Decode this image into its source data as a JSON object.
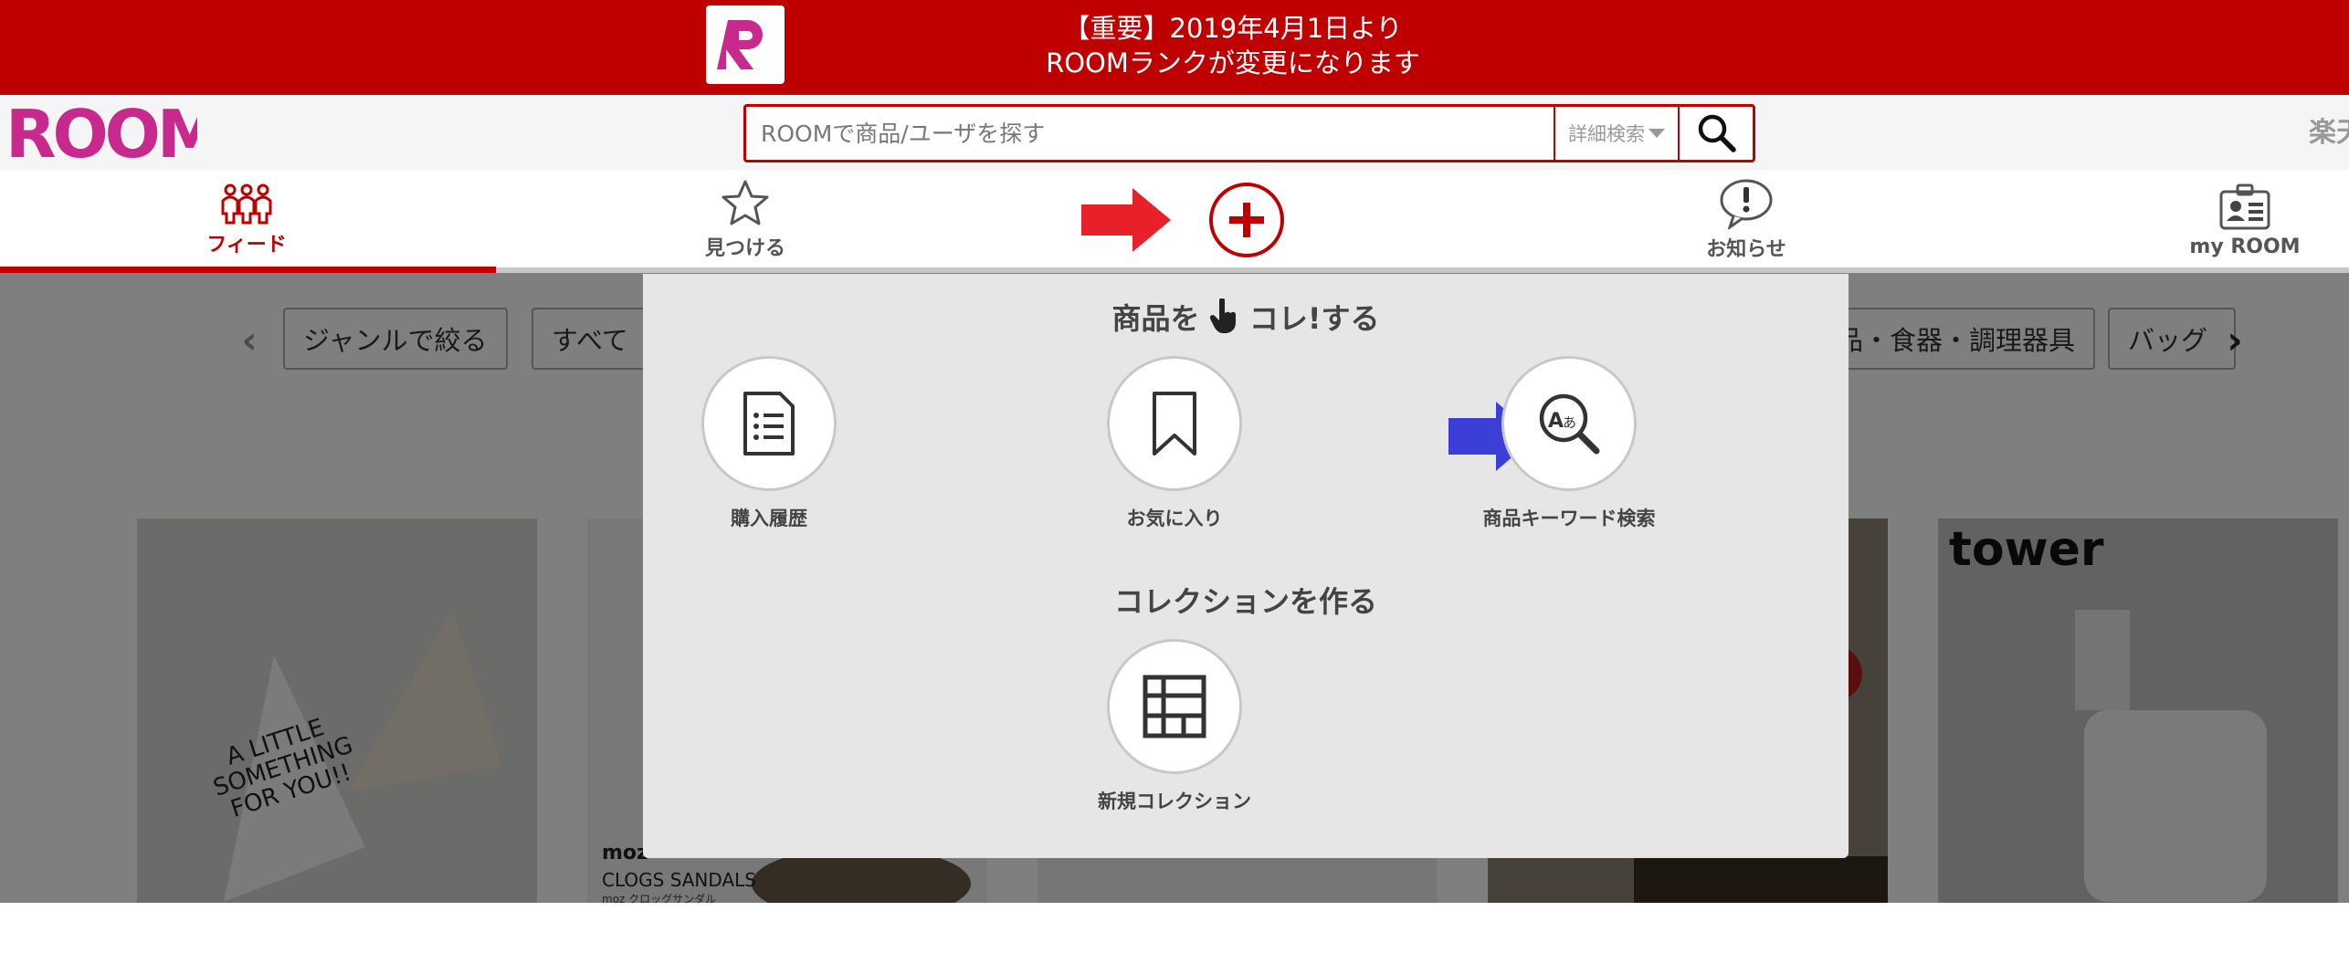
{
  "banner": {
    "line1": "【重要】2019年4月1日より",
    "line2": "ROOMランクが変更になります",
    "logo_letter": "R"
  },
  "header": {
    "logo_text": "ROOM",
    "search_placeholder": "ROOMで商品/ユーザを探す",
    "detail_search_label": "詳細検索",
    "rakuten_text": "楽天"
  },
  "nav": {
    "items": [
      {
        "label": "フィード",
        "icon": "people-icon",
        "active": true
      },
      {
        "label": "見つける",
        "icon": "star-icon"
      },
      {
        "label": "お知らせ",
        "icon": "notification-icon"
      },
      {
        "label": "my ROOM",
        "icon": "id-card-icon"
      }
    ]
  },
  "filters": {
    "genre_label": "ジャンルで絞る",
    "all_label": "すべて",
    "partial_label": "品・食器・調理器具",
    "bag_label": "バッグ"
  },
  "cards": {
    "card1_text": "A LITTLE SOMETHING FOR YOU!!",
    "card2_brand": "moz",
    "card2_caption": "CLOGS SANDALS",
    "card2_subcaption": "moz クロッグサンダル",
    "card5_text": "tower"
  },
  "modal": {
    "section1_title_prefix": "商品を",
    "section1_title_suffix": "コレ!する",
    "actions": [
      {
        "label": "購入履歴",
        "icon": "document-list-icon"
      },
      {
        "label": "お気に入り",
        "icon": "bookmark-icon"
      },
      {
        "label": "商品キーワード検索",
        "icon": "keyword-search-icon"
      }
    ],
    "section2_title": "コレクションを作る",
    "collection_label": "新規コレクション"
  },
  "colors": {
    "brand_red": "#bf0000",
    "logo_pink": "#c7298c",
    "annotation_red": "#e8202a",
    "annotation_blue": "#3b3fd8"
  }
}
